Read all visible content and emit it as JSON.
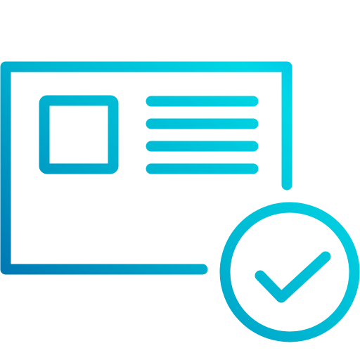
{
  "icon": {
    "name": "approved-card-icon",
    "parts": [
      "card-frame",
      "photo-placeholder",
      "text-lines",
      "check-badge"
    ]
  },
  "colors": {
    "gradient_start": "#0061A8",
    "gradient_mid": "#00B4D0",
    "gradient_end": "#00D8E6",
    "gradient_accent": "#00A8EE",
    "background": "#FFFFFF"
  }
}
